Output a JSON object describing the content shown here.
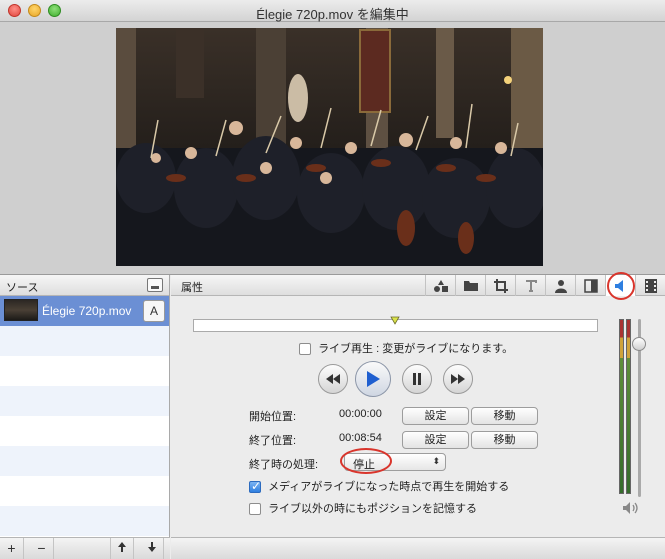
{
  "window": {
    "title": "Élegie 720p.mov を編集中"
  },
  "source_pane": {
    "header": "ソース",
    "items": [
      {
        "name": "Élegie 720p.mov",
        "badge": "A"
      }
    ],
    "footer": {
      "add": "+",
      "remove": "−",
      "up": "⬆",
      "down": "⬇"
    }
  },
  "properties_pane": {
    "header": "属性",
    "tabs": [
      {
        "icon": "shapes-icon"
      },
      {
        "icon": "folder-icon"
      },
      {
        "icon": "crop-icon"
      },
      {
        "icon": "text-icon"
      },
      {
        "icon": "person-icon"
      },
      {
        "icon": "layout-icon"
      },
      {
        "icon": "speaker-icon",
        "active": true
      },
      {
        "icon": "filmstrip-icon"
      }
    ],
    "live_play_label": "ライブ再生 : 変更がライブになります。",
    "live_play_checked": false,
    "start_label": "開始位置:",
    "start_time": "00:00:00",
    "end_label": "終了位置:",
    "end_time": "00:08:54",
    "set_label": "設定",
    "move_label": "移動",
    "on_end_label": "終了時の処理:",
    "on_end_value": "停止",
    "start_on_live_label": "メディアがライブになった時点で再生を開始する",
    "start_on_live_checked": true,
    "remember_position_label": "ライブ以外の時にもポジションを記憶する",
    "remember_position_checked": false
  },
  "colors": {
    "accent": "#2f7fe0",
    "selection": "#6b8fd4",
    "annotation": "#d9352c"
  }
}
